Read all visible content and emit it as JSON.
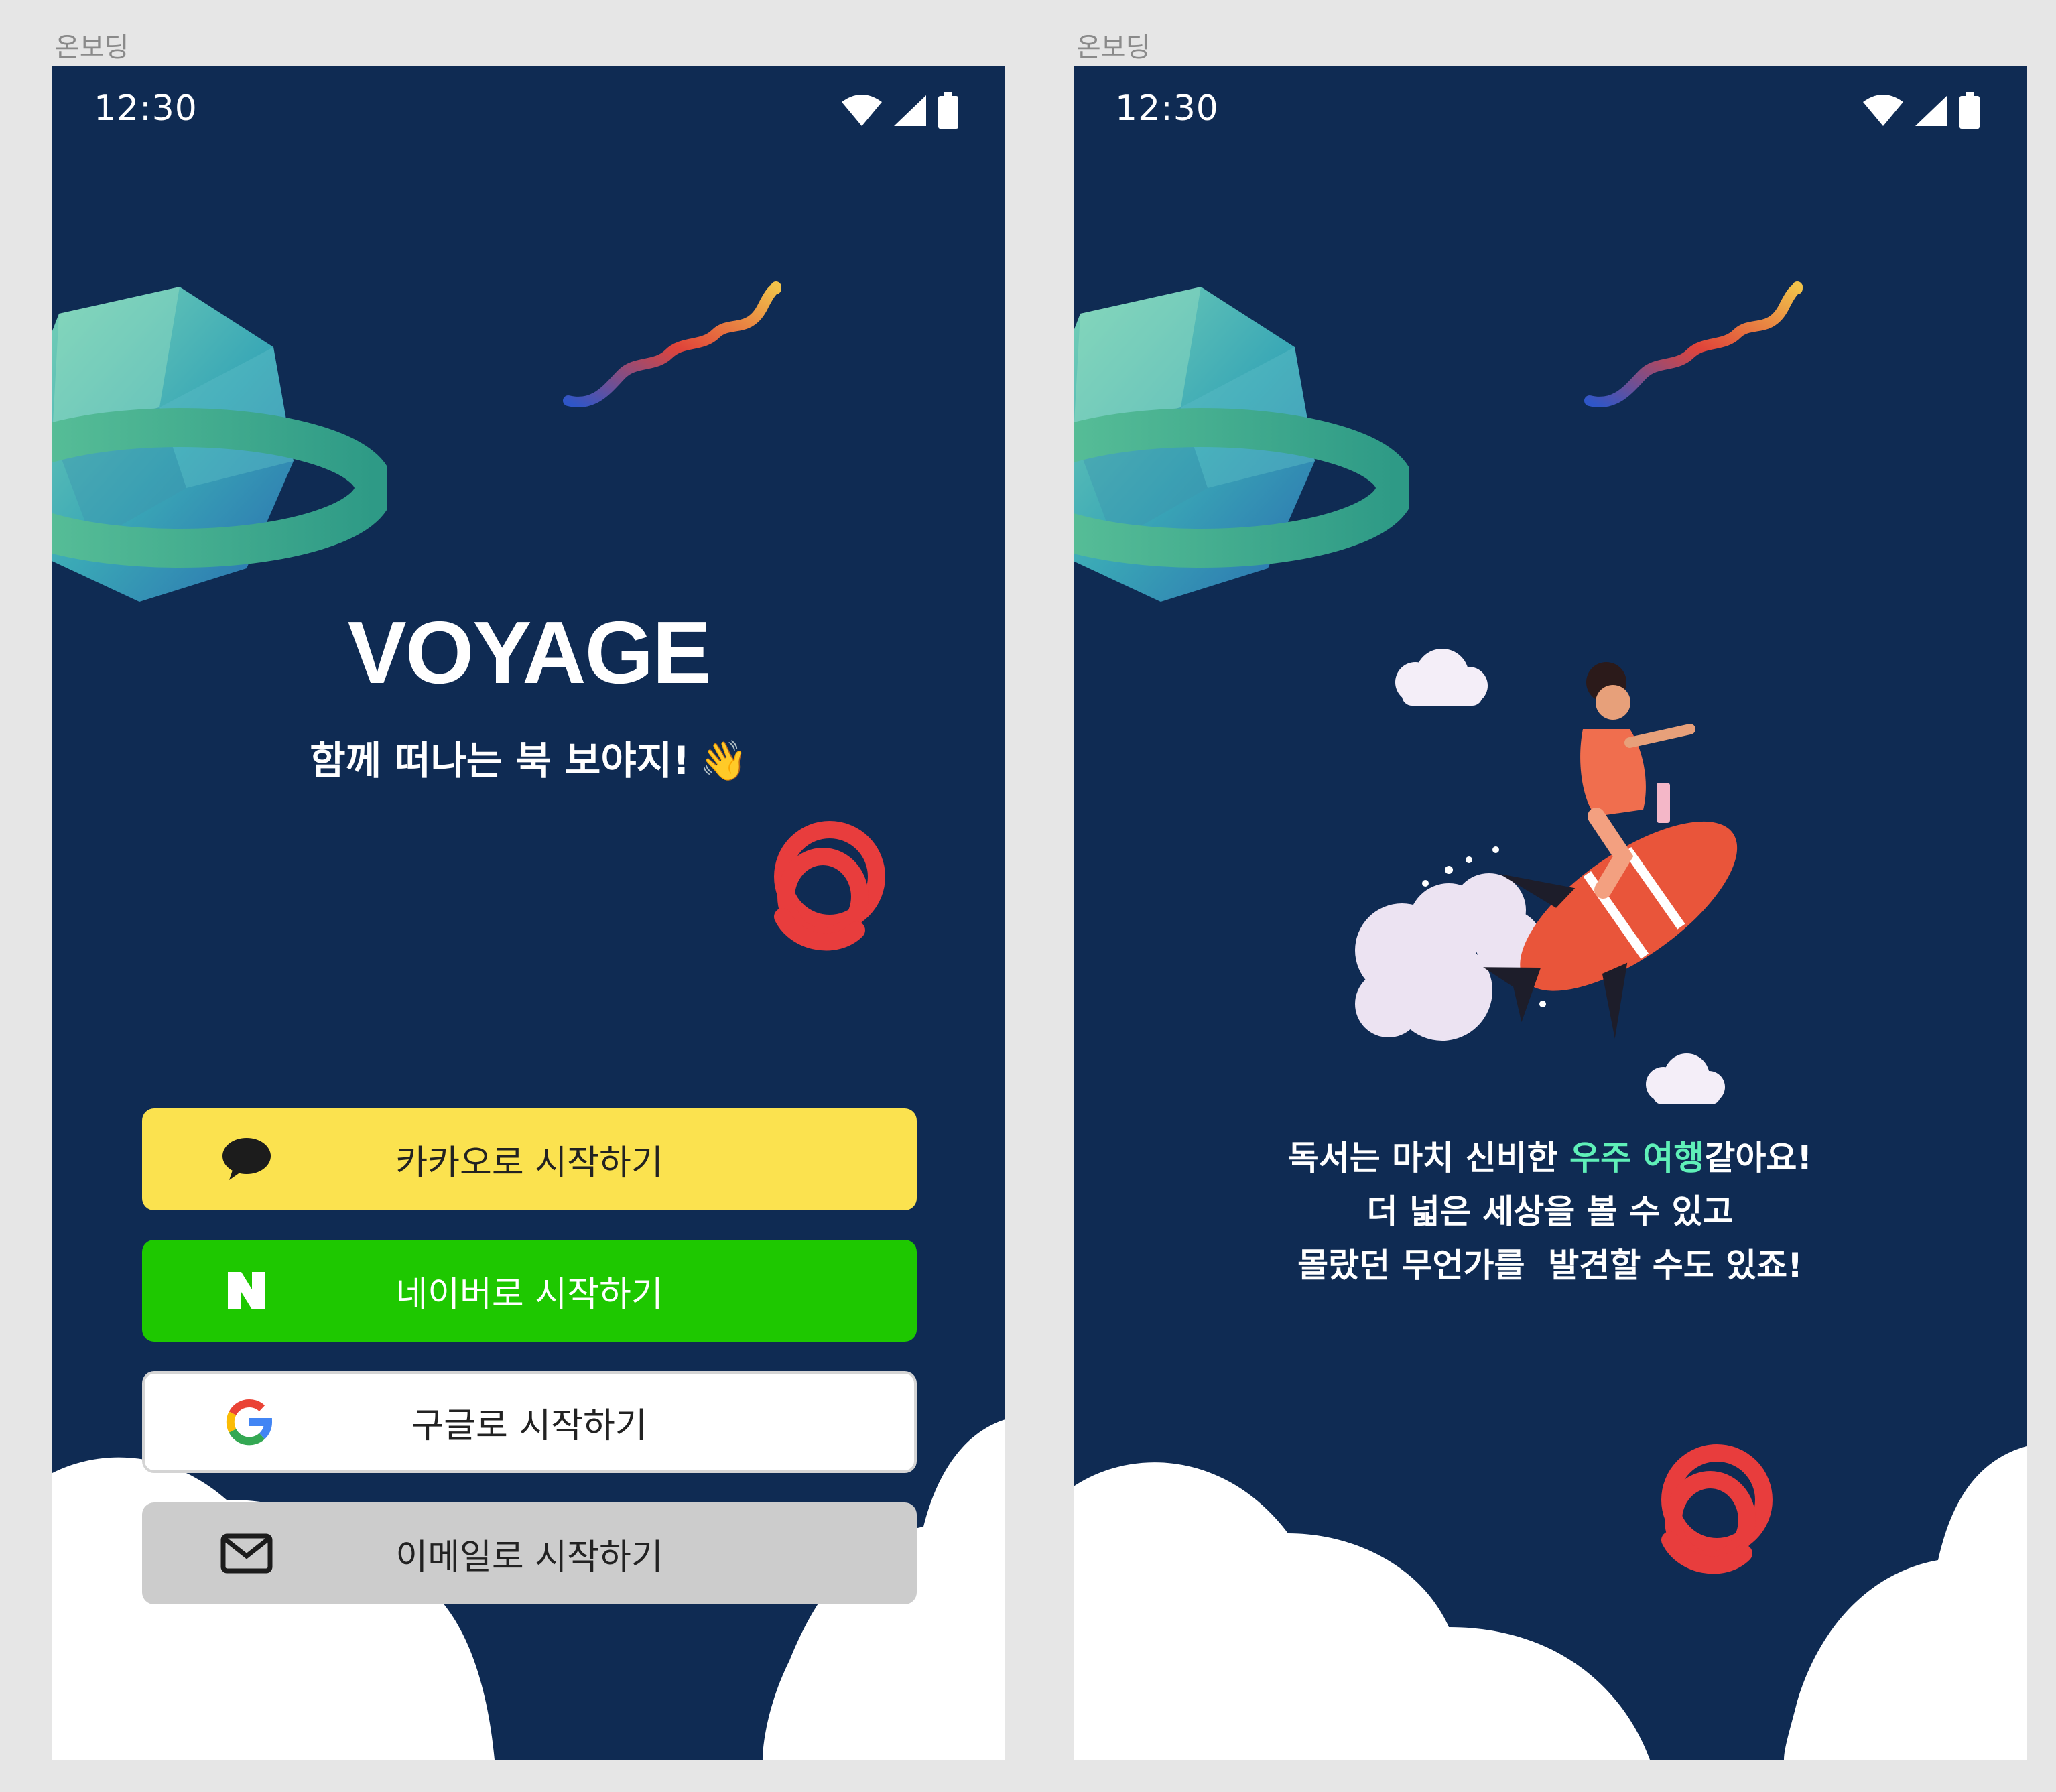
{
  "frames": [
    {
      "label": "온보딩"
    },
    {
      "label": "온보딩"
    }
  ],
  "status_bar": {
    "time": "12:30",
    "icons": [
      "wifi-icon",
      "signal-icon",
      "battery-icon"
    ]
  },
  "login_screen": {
    "title": "VOYAGE",
    "subtitle": "함께 떠나는 북 보야지!",
    "subtitle_emoji": "👋",
    "buttons": [
      {
        "label": "카카오로 시작하기",
        "icon": "kakao-chat-icon",
        "color": "#fbe24f"
      },
      {
        "label": "네이버로 시작하기",
        "icon": "naver-logo-icon",
        "color": "#1ec800"
      },
      {
        "label": "구글로 시작하기",
        "icon": "google-logo-icon",
        "color": "#ffffff"
      },
      {
        "label": "이메일로 시작하기",
        "icon": "mail-icon",
        "color": "#cccccc"
      }
    ]
  },
  "intro_screen": {
    "line1_before": "독서는 마치 신비한 ",
    "line1_highlight": "우주 여행",
    "line1_after": "같아요!",
    "line2": "더 넓은 세상을 볼 수 있고",
    "line3": "몰랐던 무언가를  발견할 수도 있죠!"
  },
  "colors": {
    "background": "#0f2b53",
    "highlight": "#5ff0b8"
  }
}
